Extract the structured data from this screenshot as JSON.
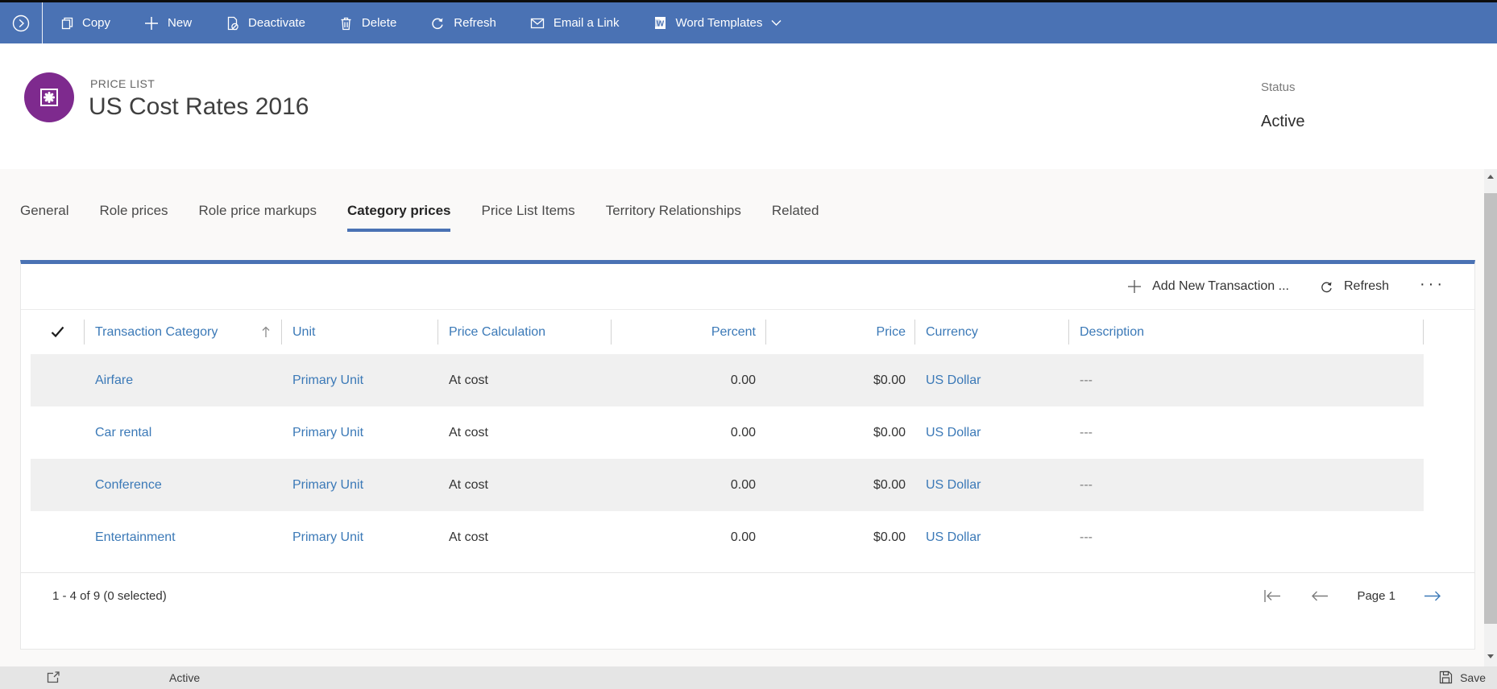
{
  "command_bar": {
    "buttons": [
      {
        "label": "Copy"
      },
      {
        "label": "New"
      },
      {
        "label": "Deactivate"
      },
      {
        "label": "Delete"
      },
      {
        "label": "Refresh"
      },
      {
        "label": "Email a Link"
      },
      {
        "label": "Word Templates"
      }
    ]
  },
  "record_header": {
    "entity_type": "PRICE LIST",
    "title": "US Cost Rates 2016",
    "status_label": "Status",
    "status_value": "Active"
  },
  "tabs": {
    "items": [
      "General",
      "Role prices",
      "Role price markups",
      "Category prices",
      "Price List Items",
      "Territory Relationships",
      "Related"
    ],
    "active": "Category prices"
  },
  "grid": {
    "toolbar": {
      "add_new_label": "Add New Transaction ...",
      "refresh_label": "Refresh",
      "more_label": "···"
    },
    "columns": [
      "Transaction Category",
      "Unit",
      "Price Calculation",
      "Percent",
      "Price",
      "Currency",
      "Description"
    ],
    "sort": {
      "column": "Transaction Category",
      "direction": "ascending"
    },
    "rows": [
      {
        "category": "Airfare",
        "unit": "Primary Unit",
        "price_calculation": "At cost",
        "percent": "0.00",
        "price": "$0.00",
        "currency": "US Dollar",
        "description": "---"
      },
      {
        "category": "Car rental",
        "unit": "Primary Unit",
        "price_calculation": "At cost",
        "percent": "0.00",
        "price": "$0.00",
        "currency": "US Dollar",
        "description": "---"
      },
      {
        "category": "Conference",
        "unit": "Primary Unit",
        "price_calculation": "At cost",
        "percent": "0.00",
        "price": "$0.00",
        "currency": "US Dollar",
        "description": "---"
      },
      {
        "category": "Entertainment",
        "unit": "Primary Unit",
        "price_calculation": "At cost",
        "percent": "0.00",
        "price": "$0.00",
        "currency": "US Dollar",
        "description": "---"
      }
    ],
    "footer": {
      "record_count": "1 - 4 of 9 (0 selected)",
      "page_label": "Page 1"
    }
  },
  "status_bar": {
    "record_state": "Active",
    "save_label": "Save"
  },
  "icons": {
    "command_expand": "circled-chevron-right",
    "copy": "copy-pages",
    "new": "plus",
    "deactivate": "document-blocked",
    "delete": "trash-can",
    "refresh": "circular-arrow",
    "email_a_link": "envelope",
    "word_templates": "word-document",
    "dropdown": "chevron-down",
    "select_all": "checkmark",
    "sort_ascending": "arrow-up",
    "add_new": "plus",
    "more_commands": "ellipsis",
    "first_page": "arrow-bar-left",
    "previous_page": "arrow-left",
    "next_page": "arrow-right",
    "form_popout": "expand-square-arrow",
    "save": "floppy-disk",
    "entity": "starburst-in-square",
    "scroll_up": "triangle-up",
    "scroll_down": "triangle-down"
  },
  "colors": {
    "command_bar": "#4a72b4",
    "link": "#3b79b7",
    "entity_icon": "#7e2a8e",
    "tab_underline": "#4a72b4",
    "row_alt": "#f0f0f0",
    "page_bg": "#faf9f8",
    "status_bar_bg": "#e5e5e5"
  }
}
